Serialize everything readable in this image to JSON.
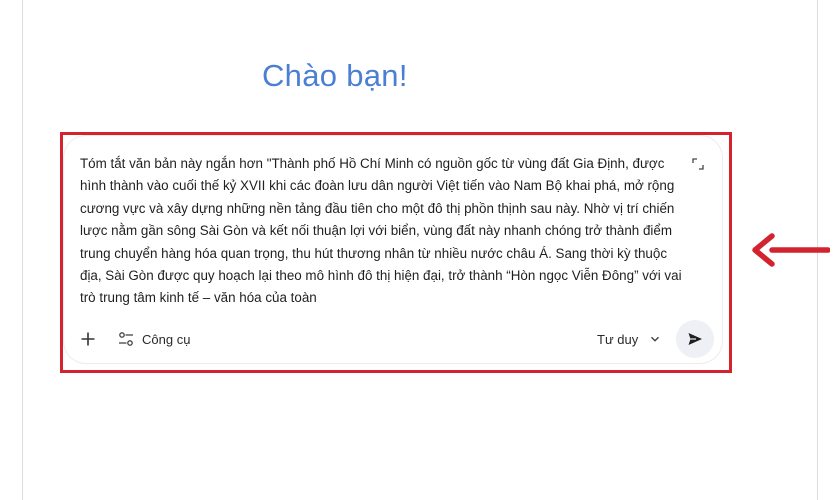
{
  "greeting": "Chào bạn!",
  "prompt": {
    "text": "Tóm tắt văn bản này ngắn hơn \"Thành phố Hồ Chí Minh có nguồn gốc từ vùng đất Gia Định, được hình thành vào cuối thế kỷ XVII khi các đoàn lưu dân người Việt tiến vào Nam Bộ khai phá, mở rộng cương vực và xây dựng những nền tảng đầu tiên cho một đô thị phồn thịnh sau này. Nhờ vị trí chiến lược nằm gần sông Sài Gòn và kết nối thuận lợi với biển, vùng đất này nhanh chóng trở thành điểm trung chuyển hàng hóa quan trọng, thu hút thương nhân từ nhiều nước châu Á. Sang thời kỳ thuộc địa, Sài Gòn được quy hoạch lại theo mô hình đô thị hiện đại, trở thành “Hòn ngọc Viễn Đông” với vai trò trung tâm kinh tế – văn hóa của toàn"
  },
  "toolbar": {
    "add_icon": "plus-icon",
    "tools_icon": "tools-sliders-icon",
    "tools_label": "Công cụ",
    "mode_label": "Tư duy",
    "mode_icon": "chevron-down-icon",
    "send_icon": "send-icon"
  },
  "colors": {
    "greeting": "#4a7fd4",
    "highlight": "#d2232f",
    "arrow": "#d2232f",
    "send_bg": "#eef0f6"
  }
}
